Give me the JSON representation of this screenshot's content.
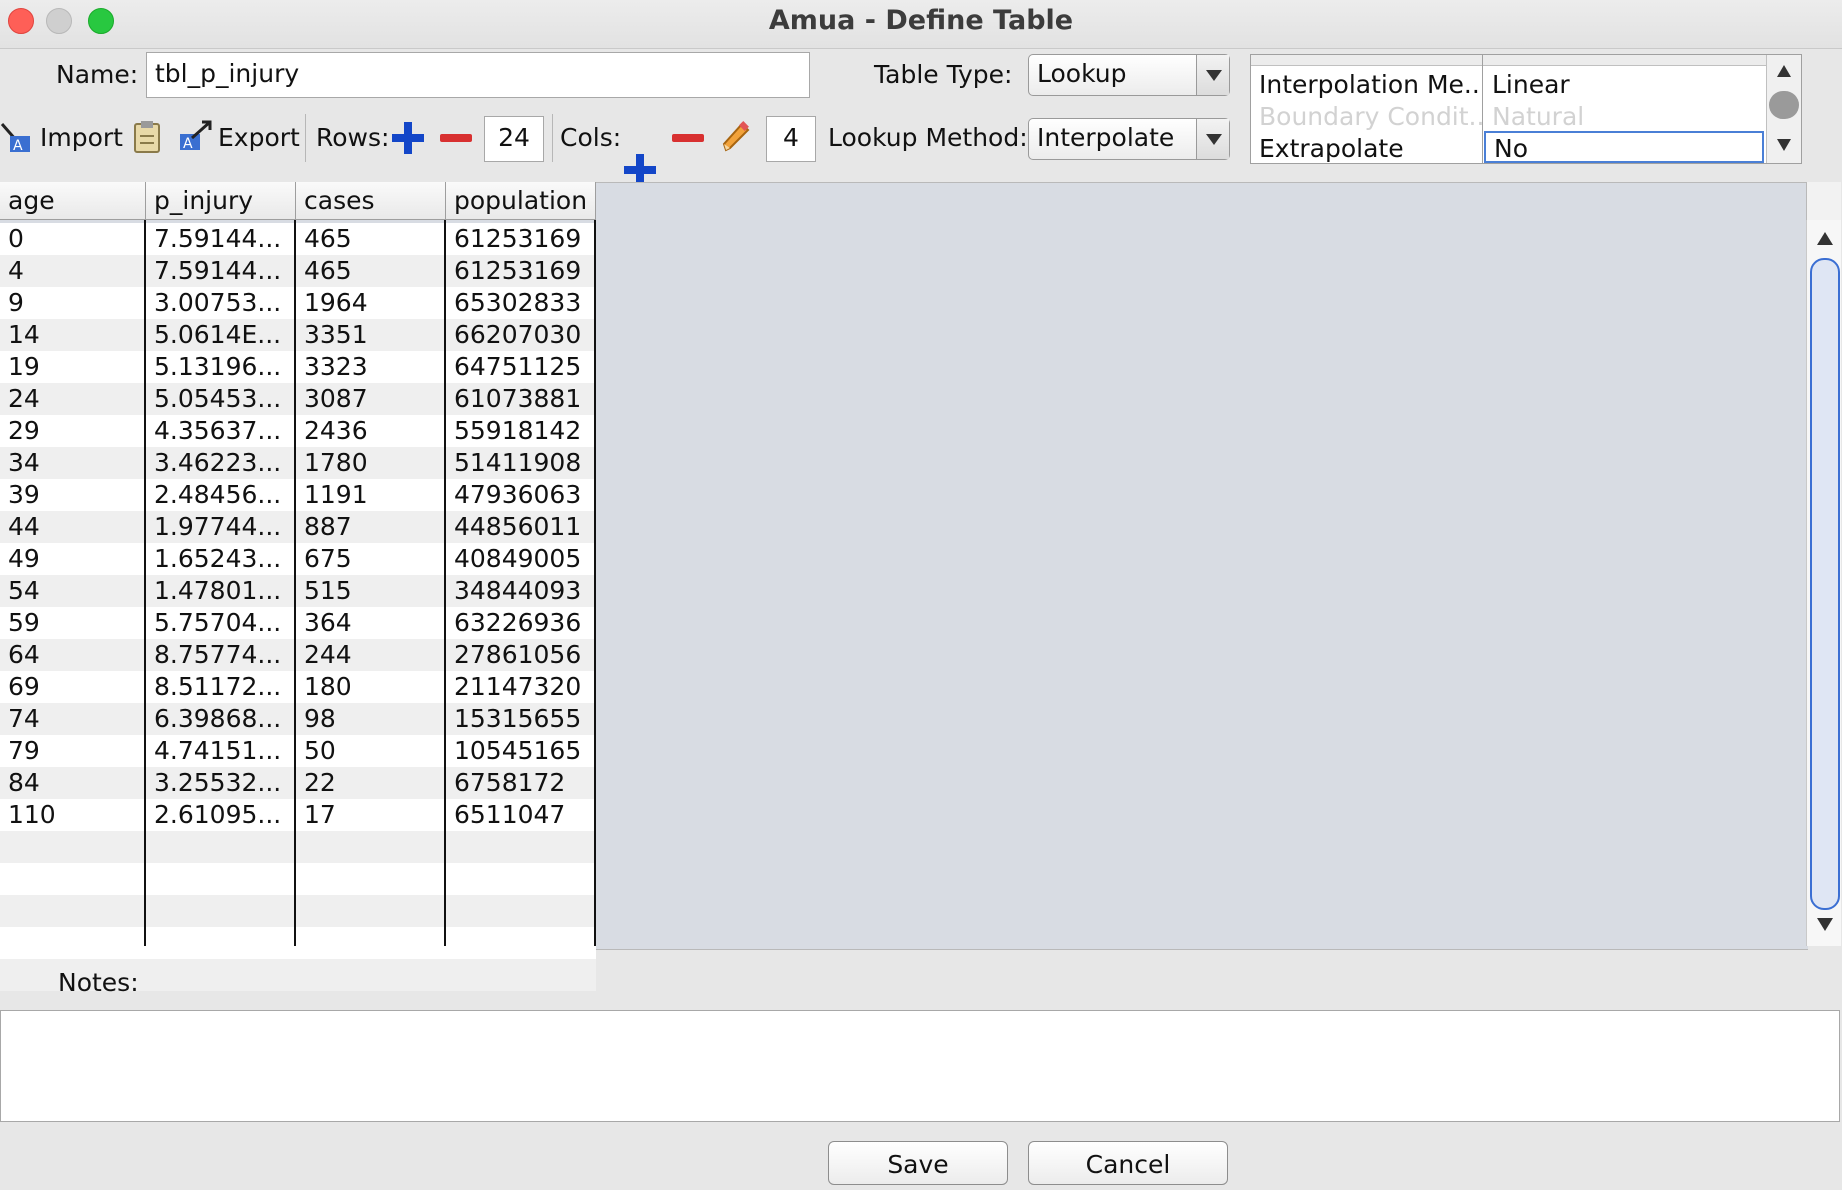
{
  "window": {
    "title": "Amua - Define Table"
  },
  "name_field": {
    "label": "Name:",
    "value": "tbl_p_injury"
  },
  "table_type": {
    "label": "Table Type:",
    "selected": "Lookup"
  },
  "lookup_method": {
    "label": "Lookup Method:",
    "selected": "Interpolate"
  },
  "toolbar": {
    "import_label": "Import",
    "export_label": "Export",
    "rows_label": "Rows:",
    "rows_value": "24",
    "cols_label": "Cols:",
    "cols_value": "4"
  },
  "properties": [
    {
      "name": "Interpolation Me...",
      "value": "Linear",
      "enabled": true
    },
    {
      "name": "Boundary Condit...",
      "value": "Natural",
      "enabled": false
    },
    {
      "name": "Extrapolate",
      "value": "No",
      "enabled": true
    }
  ],
  "table": {
    "headers": [
      "age",
      "p_injury",
      "cases",
      "population"
    ],
    "rows": [
      [
        "0",
        "7.59144...",
        "465",
        "61253169"
      ],
      [
        "4",
        "7.59144...",
        "465",
        "61253169"
      ],
      [
        "9",
        "3.00753...",
        "1964",
        "65302833"
      ],
      [
        "14",
        "5.0614E...",
        "3351",
        "66207030"
      ],
      [
        "19",
        "5.13196...",
        "3323",
        "64751125"
      ],
      [
        "24",
        "5.05453...",
        "3087",
        "61073881"
      ],
      [
        "29",
        "4.35637...",
        "2436",
        "55918142"
      ],
      [
        "34",
        "3.46223...",
        "1780",
        "51411908"
      ],
      [
        "39",
        "2.48456...",
        "1191",
        "47936063"
      ],
      [
        "44",
        "1.97744...",
        "887",
        "44856011"
      ],
      [
        "49",
        "1.65243...",
        "675",
        "40849005"
      ],
      [
        "54",
        "1.47801...",
        "515",
        "34844093"
      ],
      [
        "59",
        "5.75704...",
        "364",
        "63226936"
      ],
      [
        "64",
        "8.75774...",
        "244",
        "27861056"
      ],
      [
        "69",
        "8.51172...",
        "180",
        "21147320"
      ],
      [
        "74",
        "6.39868...",
        "98",
        "15315655"
      ],
      [
        "79",
        "4.74151...",
        "50",
        "10545165"
      ],
      [
        "84",
        "3.25532...",
        "22",
        "6758172"
      ],
      [
        "110",
        "2.61095...",
        "17",
        "6511047"
      ],
      [
        "",
        "",
        "",
        ""
      ],
      [
        "",
        "",
        "",
        ""
      ],
      [
        "",
        "",
        "",
        ""
      ],
      [
        "",
        "",
        "",
        ""
      ],
      [
        "",
        "",
        "",
        ""
      ]
    ]
  },
  "notes": {
    "label": "Notes:",
    "value": ""
  },
  "buttons": {
    "save": "Save",
    "cancel": "Cancel"
  },
  "colors": {
    "close": "#fe5f57",
    "minimize": "#c9c9c9",
    "maximize": "#28c840",
    "add_icon": "#1346c8",
    "remove_icon": "#d83030"
  }
}
